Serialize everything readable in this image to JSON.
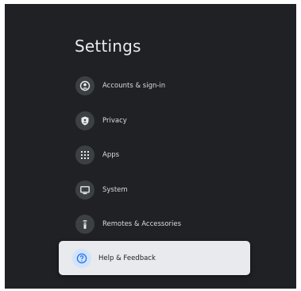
{
  "settings": {
    "title": "Settings",
    "items": [
      {
        "label": "Accounts & sign-in",
        "icon": "account-icon"
      },
      {
        "label": "Privacy",
        "icon": "shield-icon"
      },
      {
        "label": "Apps",
        "icon": "apps-grid-icon"
      },
      {
        "label": "System",
        "icon": "monitor-icon"
      },
      {
        "label": "Remotes & Accessories",
        "icon": "remote-icon"
      },
      {
        "label": "Help & Feedback",
        "icon": "help-icon",
        "focused": true
      }
    ]
  },
  "colors": {
    "background": "#202124",
    "icon_circle": "#3c4043",
    "focus_card": "#e8eaed",
    "help_accent": "#1a73e8"
  }
}
